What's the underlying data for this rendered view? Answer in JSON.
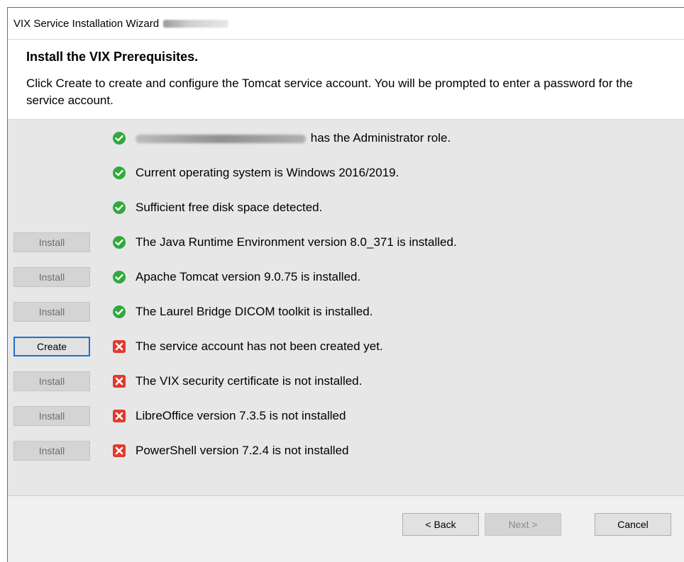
{
  "window": {
    "title": "VIX Service Installation Wizard"
  },
  "header": {
    "heading": "Install the VIX Prerequisites.",
    "description": "Click Create to create and configure the Tomcat service account. You will be prompted to enter a password for the service account."
  },
  "colors": {
    "success": "#2faa3c",
    "error": "#e03a2e",
    "focus": "#1a72cc"
  },
  "items": [
    {
      "button": "",
      "status": "success",
      "text": "has the Administrator role.",
      "redacted_prefix": true
    },
    {
      "button": "",
      "status": "success",
      "text": "Current operating system is Windows 2016/2019."
    },
    {
      "button": "",
      "status": "success",
      "text": "Sufficient free disk space detected."
    },
    {
      "button": "Install",
      "button_enabled": false,
      "status": "success",
      "text": "The Java Runtime Environment version 8.0_371 is installed."
    },
    {
      "button": "Install",
      "button_enabled": false,
      "status": "success",
      "text": "Apache Tomcat version 9.0.75 is installed."
    },
    {
      "button": "Install",
      "button_enabled": false,
      "status": "success",
      "text": "The Laurel Bridge DICOM toolkit is installed."
    },
    {
      "button": "Create",
      "button_enabled": true,
      "status": "error",
      "text": "The service account has not been created yet."
    },
    {
      "button": "Install",
      "button_enabled": false,
      "status": "error",
      "text": "The VIX security certificate is not installed."
    },
    {
      "button": "Install",
      "button_enabled": false,
      "status": "error",
      "text": "LibreOffice version 7.3.5 is not installed"
    },
    {
      "button": "Install",
      "button_enabled": false,
      "status": "error",
      "text": "PowerShell version 7.2.4 is not installed"
    }
  ],
  "footer": {
    "back_label": "< Back",
    "next_label": "Next >",
    "cancel_label": "Cancel"
  }
}
